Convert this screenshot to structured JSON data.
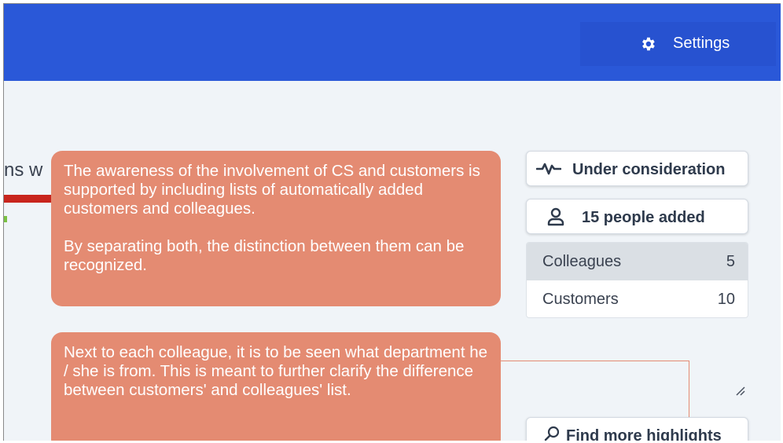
{
  "header": {
    "settings_label": "Settings",
    "settings_icon": "gear-icon",
    "bar_color": "#2a58d8"
  },
  "main": {
    "heading_fragment": "ns w"
  },
  "annotations": [
    {
      "paragraphs": [
        "The awareness of the involvement of CS and customers is supported by including lists of automatically added customers and colleagues.",
        "By separating both, the distinction between them can be recognized."
      ],
      "color": "#e48b72"
    },
    {
      "paragraphs": [
        "Next to each colleague, it is to be seen what department he / she is from. This is meant to further clarify the difference between customers' and colleagues' list."
      ],
      "color": "#e48b72"
    }
  ],
  "sidebar": {
    "status_label": "Under consideration",
    "status_icon": "activity-icon",
    "people_label": "15 people added",
    "people_icon": "user-icon",
    "groups": [
      {
        "name": "Colleagues",
        "count": "5"
      },
      {
        "name": "Customers",
        "count": "10"
      }
    ],
    "find_label": "Find more highlights",
    "find_icon": "search-icon"
  }
}
